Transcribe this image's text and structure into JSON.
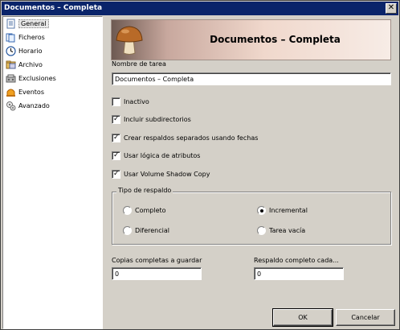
{
  "window": {
    "title": "Documentos – Completa",
    "close_symbol": "✕"
  },
  "sidebar": {
    "items": [
      {
        "label": "General",
        "icon": "general-page-icon",
        "active": true
      },
      {
        "label": "Ficheros",
        "icon": "files-icon"
      },
      {
        "label": "Horario",
        "icon": "clock-icon"
      },
      {
        "label": "Archivo",
        "icon": "archive-icon"
      },
      {
        "label": "Exclusiones",
        "icon": "exclusions-icon"
      },
      {
        "label": "Eventos",
        "icon": "events-icon"
      },
      {
        "label": "Avanzado",
        "icon": "advanced-icon"
      }
    ]
  },
  "header": {
    "title": "Documentos – Completa",
    "icon": "mushroom-icon"
  },
  "form": {
    "task_name_label": "Nombre de tarea",
    "task_name_value": "Documentos – Completa",
    "checkboxes": [
      {
        "label": "Inactivo",
        "checked": false
      },
      {
        "label": "Incluir subdirectorios",
        "checked": true
      },
      {
        "label": "Crear respaldos separados usando fechas",
        "checked": true
      },
      {
        "label": "Usar lógica de atributos",
        "checked": true
      },
      {
        "label": "Usar Volume Shadow Copy",
        "checked": true
      }
    ],
    "backup_type": {
      "title": "Tipo de respaldo",
      "options": [
        {
          "label": "Completo",
          "selected": false
        },
        {
          "label": "Incremental",
          "selected": true
        },
        {
          "label": "Diferencial",
          "selected": false
        },
        {
          "label": "Tarea vacía",
          "selected": false
        }
      ]
    },
    "full_copies_label": "Copias completas a guardar",
    "full_copies_value": "0",
    "full_backup_every_label": "Respaldo completo cada...",
    "full_backup_every_value": "0"
  },
  "buttons": {
    "ok": "OK",
    "cancel": "Cancelar"
  }
}
